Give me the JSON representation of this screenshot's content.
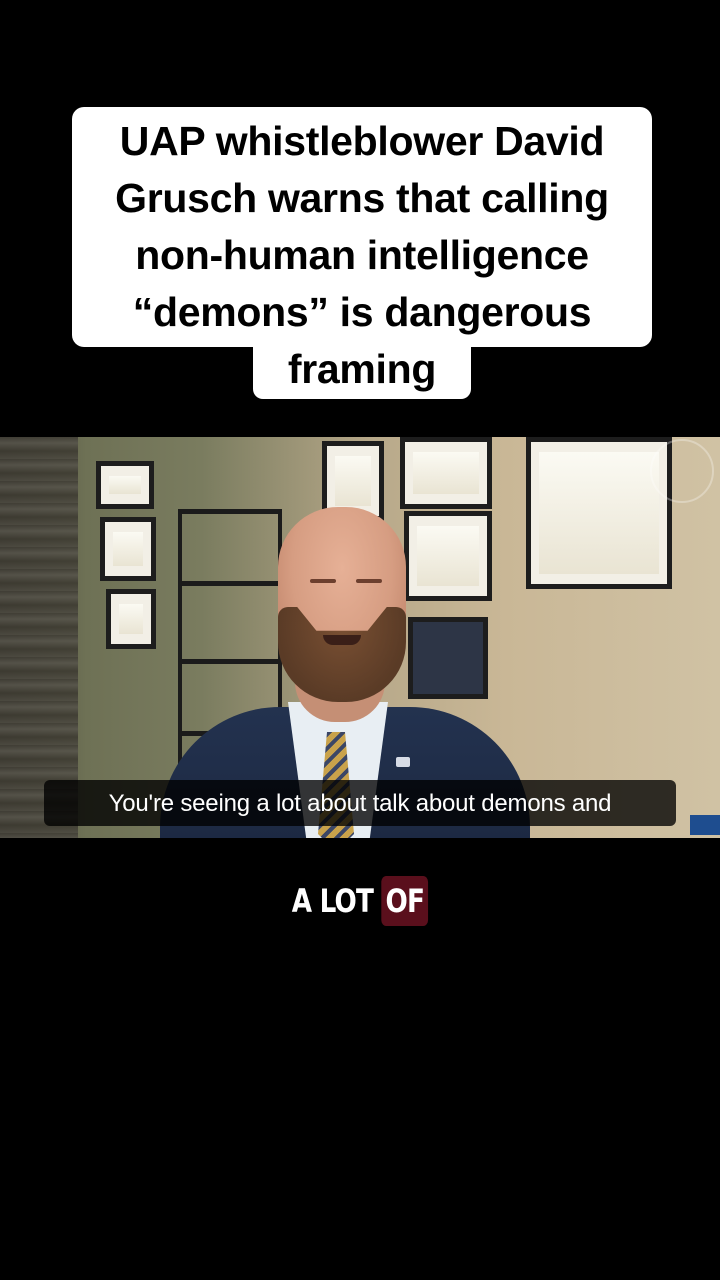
{
  "caption": {
    "text": "UAP whistleblower David\nGrusch warns that calling\nnon-human intelligence\n“demons” is dangerous\nframing"
  },
  "video": {
    "subtitle": "You're seeing a lot about talk about demons and",
    "watermark_text": ""
  },
  "karaoke": {
    "prefix": "A LOT ",
    "highlight": "OF",
    "highlight_color": "#5a0f1c"
  },
  "colors": {
    "background": "#000000",
    "caption_bg": "#ffffff",
    "caption_text": "#000000"
  }
}
